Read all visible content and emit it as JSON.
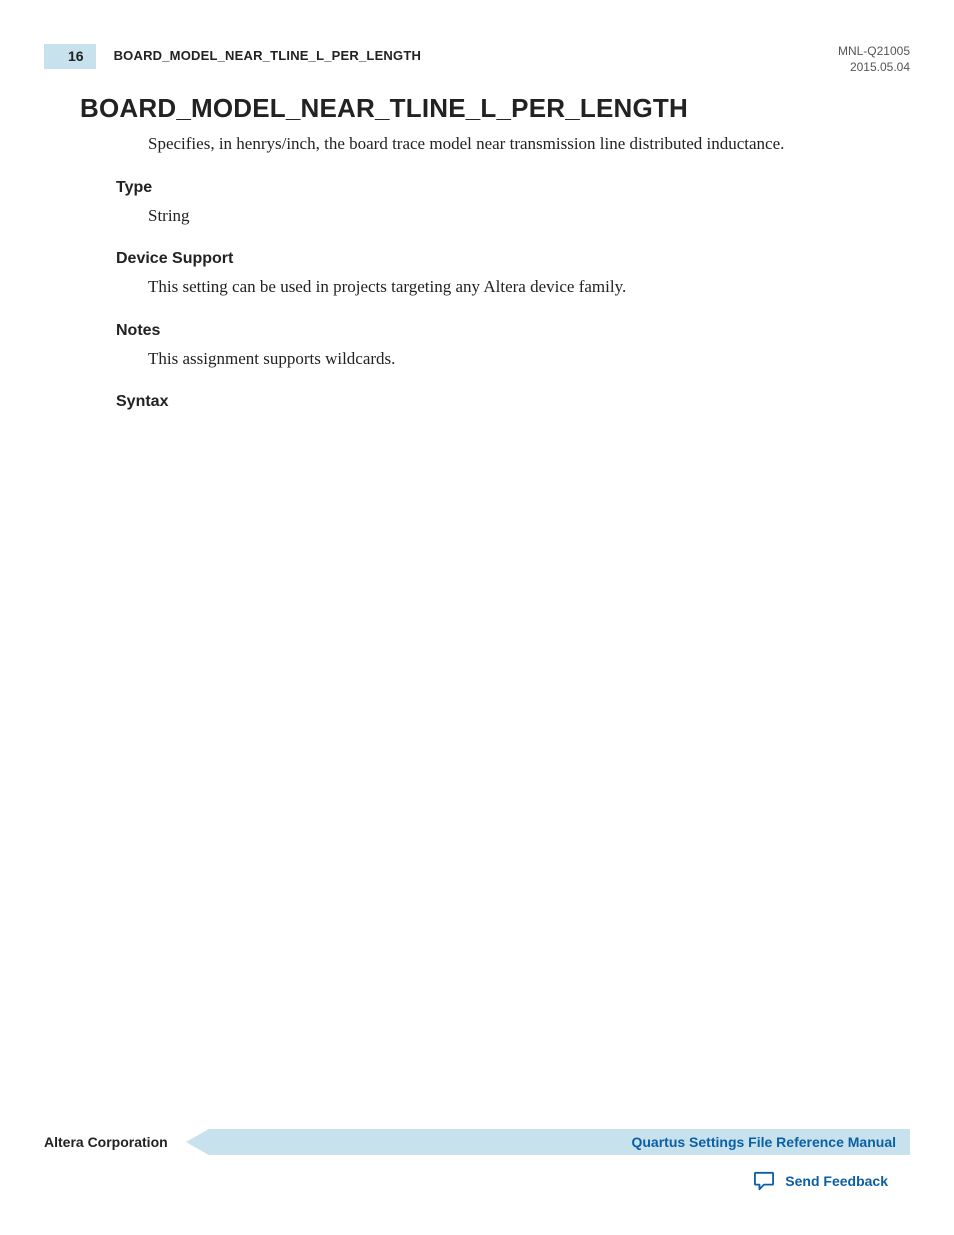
{
  "header": {
    "page_number": "16",
    "running_title": "BOARD_MODEL_NEAR_TLINE_L_PER_LENGTH",
    "doc_id": "MNL-Q21005",
    "doc_date": "2015.05.04"
  },
  "entry": {
    "title": "BOARD_MODEL_NEAR_TLINE_L_PER_LENGTH",
    "description": "Specifies, in henrys/inch, the board trace model near transmission line distributed inductance.",
    "sections": {
      "type": {
        "heading": "Type",
        "body": "String"
      },
      "device_support": {
        "heading": "Device Support",
        "body": "This setting can be used in projects targeting any Altera device family."
      },
      "notes": {
        "heading": "Notes",
        "body": "This assignment supports wildcards."
      },
      "syntax": {
        "heading": "Syntax",
        "body": ""
      }
    }
  },
  "footer": {
    "corporation": "Altera Corporation",
    "manual_title": "Quartus Settings File Reference Manual",
    "feedback_label": "Send Feedback"
  },
  "colors": {
    "header_box_bg": "#c7e2ec",
    "footer_bar_fill": "#c7e2ec",
    "link_blue": "#0b5fa5"
  }
}
